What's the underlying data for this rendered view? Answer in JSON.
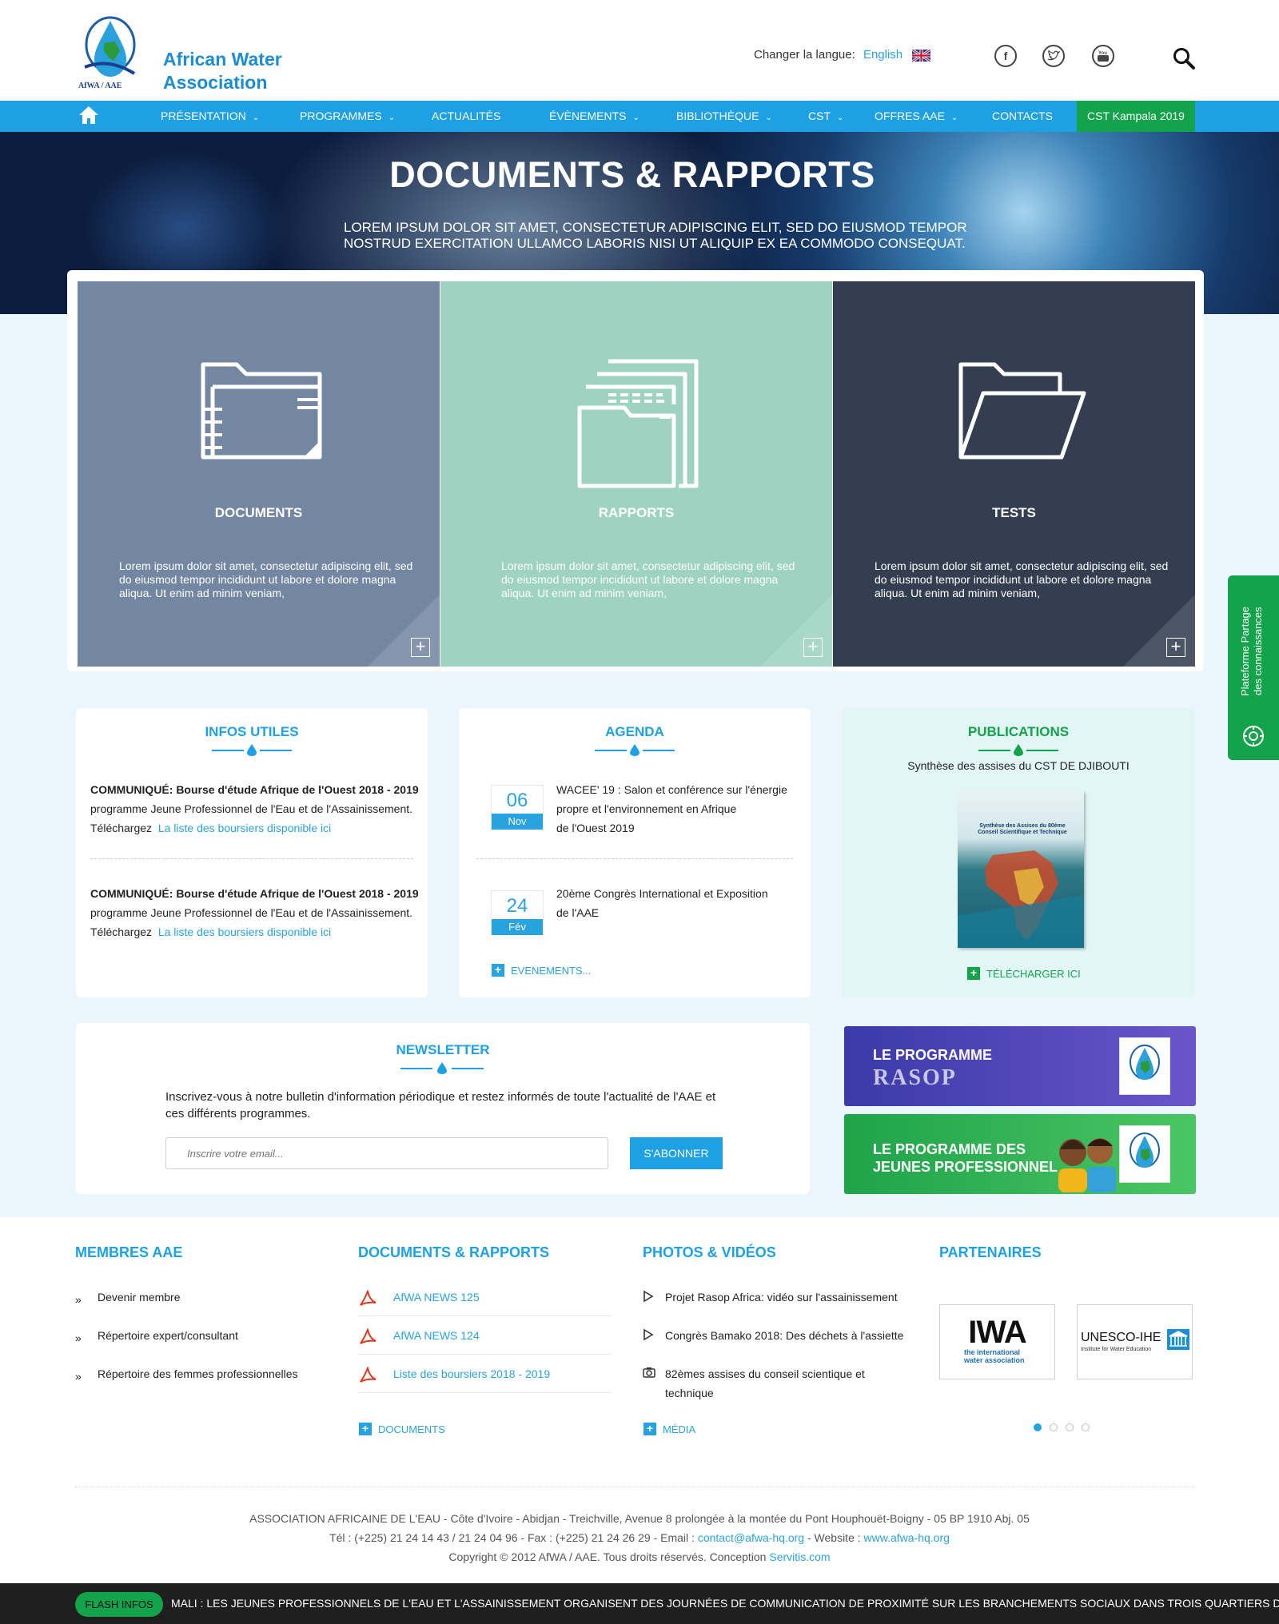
{
  "header": {
    "brand_line1": "African Water",
    "brand_line2": "Association",
    "logo_caption": "AfWA / AAE",
    "lang_label": "Changer la langue:",
    "lang_value": "English"
  },
  "nav": {
    "items": [
      {
        "label": "PRÉSENTATION",
        "has_dropdown": true
      },
      {
        "label": "PROGRAMMES",
        "has_dropdown": true
      },
      {
        "label": "ACTUALITÉS",
        "has_dropdown": false
      },
      {
        "label": "ÉVÈNEMENTS",
        "has_dropdown": true
      },
      {
        "label": "BIBLIOTHÈQUE",
        "has_dropdown": true
      },
      {
        "label": "CST",
        "has_dropdown": true
      },
      {
        "label": "OFFRES AAE",
        "has_dropdown": true
      },
      {
        "label": "CONTACTS",
        "has_dropdown": false
      }
    ],
    "highlight": "CST Kampala 2019",
    "highlight_color": "#13a34b",
    "bar_color": "#1ea1e4"
  },
  "hero": {
    "title": "DOCUMENTS & RAPPORTS",
    "subtitle_line1": "LOREM IPSUM DOLOR SIT AMET, CONSECTETUR ADIPISCING ELIT, SED DO EIUSMOD TEMPOR",
    "subtitle_line2": "NOSTRUD EXERCITATION ULLAMCO LABORIS NISI UT ALIQUIP EX EA COMMODO CONSEQUAT."
  },
  "cards": [
    {
      "title": "DOCUMENTS",
      "text": "Lorem ipsum dolor sit amet, consectetur adipiscing elit, sed do eiusmod tempor incididunt ut labore et dolore magna aliqua. Ut enim ad minim veniam,",
      "color": "#7487a2"
    },
    {
      "title": "RAPPORTS",
      "text": "Lorem ipsum dolor sit amet, consectetur adipiscing elit, sed do eiusmod tempor incididunt ut labore et dolore magna aliqua. Ut enim ad minim veniam,",
      "color": "#9fd3c1"
    },
    {
      "title": "TESTS",
      "text": "Lorem ipsum dolor sit amet, consectetur adipiscing elit, sed do eiusmod tempor incididunt ut labore et dolore magna aliqua. Ut enim ad minim veniam,",
      "color": "#343e51"
    }
  ],
  "infos": {
    "title": "INFOS UTILES",
    "items": [
      {
        "heading": "COMMUNIQUÉ: Bourse d'étude Afrique de l'Ouest 2018 - 2019",
        "body": "programme Jeune Professionnel de l'Eau et de l'Assainissement.",
        "prefix": "Téléchargez",
        "link": "La liste des boursiers disponible ici"
      },
      {
        "heading": "COMMUNIQUÉ: Bourse d'étude Afrique de l'Ouest 2018 - 2019",
        "body": "programme Jeune Professionnel de l'Eau et de l'Assainissement.",
        "prefix": "Téléchargez",
        "link": "La liste des boursiers disponible ici"
      }
    ]
  },
  "agenda": {
    "title": "AGENDA",
    "items": [
      {
        "day": "06",
        "month": "Nov",
        "line1": "WACEE' 19 : Salon et conférence sur l'énergie",
        "line2": "propre et l'environnement en Afrique",
        "line3": "de l'Ouest 2019"
      },
      {
        "day": "24",
        "month": "Fév",
        "line1": "20ème Congrès International et Exposition",
        "line2": "de l'AAE",
        "line3": ""
      }
    ],
    "more": "EVENEMENTS..."
  },
  "publications": {
    "title": "PUBLICATIONS",
    "subtitle": "Synthèse des assises du CST DE DJIBOUTI",
    "cover_title": "Synthèse des Assises du 80ème Conseil Scientifique et Technique",
    "download": "TÉLÉCHARGER ICI"
  },
  "newsletter": {
    "title": "NEWSLETTER",
    "text": "Inscrivez-vous à notre bulletin d'information périodique et restez informés de toute l'actualité de l'AAE et ces différents programmes.",
    "placeholder": "Inscrire votre email...",
    "button": "S'ABONNER"
  },
  "promos": [
    {
      "label1": "LE PROGRAMME",
      "label2": "RASOP",
      "color": "#5b43b8"
    },
    {
      "label1": "LE PROGRAMME DES",
      "label2": "JEUNES PROFESSIONNEL",
      "color": "#2eb44f"
    }
  ],
  "side_tab": {
    "line1": "Plateforme Partage",
    "line2": "des connaissances"
  },
  "footer": {
    "membres": {
      "title": "MEMBRES AAE",
      "items": [
        "Devenir membre",
        "Répertoire expert/consultant",
        "Répertoire des femmes professionnelles"
      ]
    },
    "documents": {
      "title": "DOCUMENTS & RAPPORTS",
      "items": [
        "AfWA NEWS 125",
        "AfWA NEWS 124",
        "Liste des boursiers 2018 - 2019"
      ],
      "more": "DOCUMENTS"
    },
    "media": {
      "title": "PHOTOS & VIDÉOS",
      "items": [
        "Projet Rasop Africa: vidéo sur l'assainissement",
        "Congrès Bamako 2018: Des déchets à l'assiette",
        "82èmes assises du conseil scientique et technique"
      ],
      "more": "MÉDIA"
    },
    "partners": {
      "title": "PARTENAIRES",
      "iwa_name": "IWA",
      "iwa_sub": "the international water association",
      "unesco_name": "UNESCO-IHE",
      "unesco_sub": "Institute for Water Education"
    },
    "address": "ASSOCIATION AFRICAINE DE L'EAU - Côte d'Ivoire - Abidjan - Treichville, Avenue 8 prolongée à la montée du Pont Houphouët-Boigny - 05 BP 1910 Abj. 05",
    "phone": "Tél : (+225) 21 24 14 43 / 21 24 04 96 - Fax : (+225) 21 24 26 29 - Email :",
    "email": "contact@afwa-hq.org",
    "website_label": "- Website :",
    "website": "www.afwa-hq.org",
    "copyright": "Copyright © 2012 AfWA / AAE. Tous droits réservés. Conception",
    "designer": "Servitis.com"
  },
  "flash": {
    "badge": "FLASH INFOS",
    "text": "MALI : LES JEUNES PROFESSIONNELS DE L'EAU ET L'ASSAINISSEMENT ORGANISENT DES JOURNÉES DE COMMUNICATION DE PROXIMITÉ SUR LES  BRANCHEMENTS SOCIAUX DANS TROIS QUARTIERS DU DISTRICT DE B"
  }
}
